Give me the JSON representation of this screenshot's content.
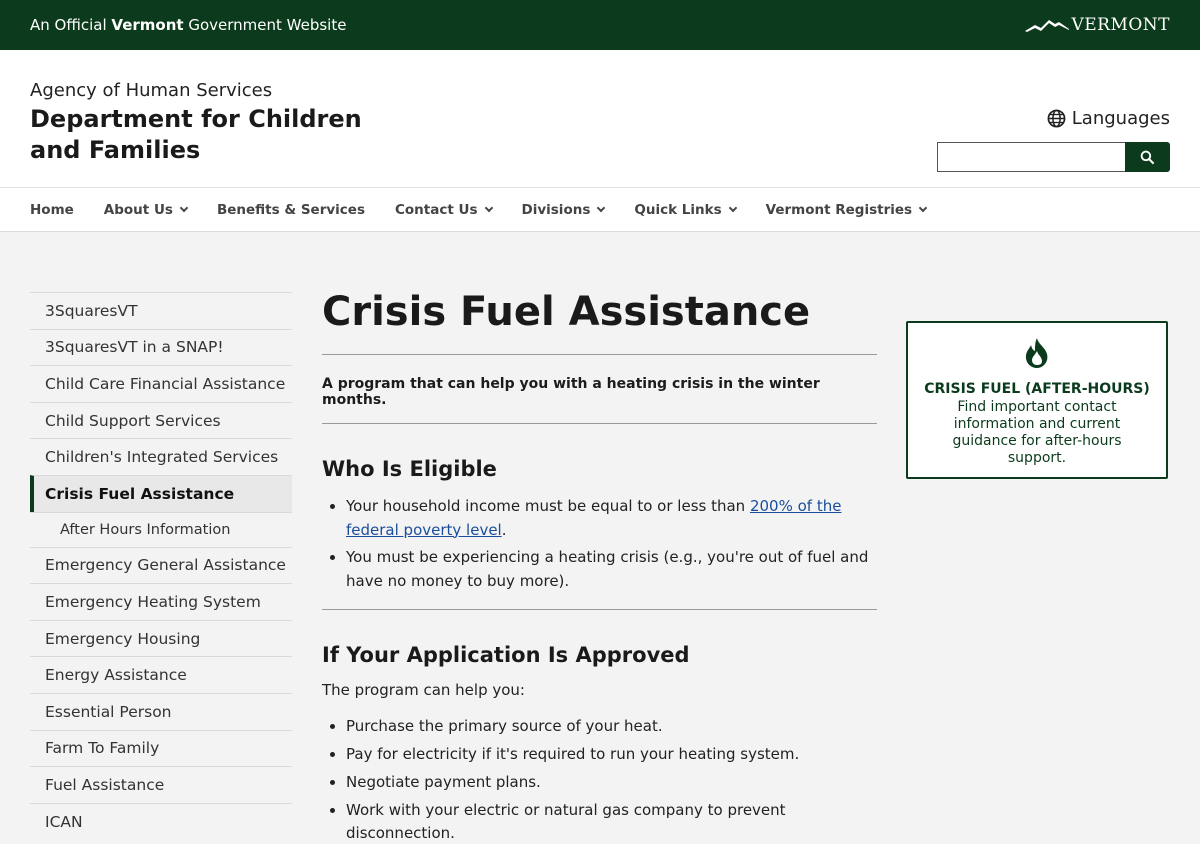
{
  "topbar": {
    "official_pre": "An Official",
    "official_bold": "Vermont",
    "official_post": "Government Website",
    "logo_text": "VERMONT"
  },
  "header": {
    "agency": "Agency of Human Services",
    "department": "Department for Children and Families",
    "languages_label": "Languages",
    "search_placeholder": ""
  },
  "nav": {
    "items": [
      {
        "label": "Home"
      },
      {
        "label": "About Us"
      },
      {
        "label": "Benefits & Services"
      },
      {
        "label": "Contact Us"
      },
      {
        "label": "Divisions"
      },
      {
        "label": "Quick Links"
      },
      {
        "label": "Vermont Registries"
      }
    ]
  },
  "sidebar": {
    "items": [
      {
        "label": "3SquaresVT"
      },
      {
        "label": "3SquaresVT in a SNAP!"
      },
      {
        "label": "Child Care Financial Assistance"
      },
      {
        "label": "Child Support Services"
      },
      {
        "label": "Children's Integrated Services"
      },
      {
        "label": "Crisis Fuel Assistance"
      },
      {
        "label": "After Hours Information"
      },
      {
        "label": "Emergency General Assistance"
      },
      {
        "label": "Emergency Heating System"
      },
      {
        "label": "Emergency Housing"
      },
      {
        "label": "Energy Assistance"
      },
      {
        "label": "Essential Person"
      },
      {
        "label": "Farm To Family"
      },
      {
        "label": "Fuel Assistance"
      },
      {
        "label": "ICAN"
      }
    ]
  },
  "main": {
    "title": "Crisis Fuel Assistance",
    "lead": "A program that can help you with a heating crisis in the winter months.",
    "eligible": {
      "heading": "Who Is Eligible",
      "item1_pre": "Your household income must be equal to or less than ",
      "item1_link": "200% of the federal poverty level",
      "item1_post": ".",
      "item2": "You must be experiencing a heating crisis (e.g., you're out of fuel and have no money to buy more)."
    },
    "approved": {
      "heading": "If Your Application Is Approved",
      "intro": "The program can help you:",
      "items": [
        "Purchase the primary source of your heat.",
        "Pay for electricity if it's required to run your heating system.",
        "Negotiate payment plans.",
        "Work with your electric or natural gas company to prevent disconnection."
      ]
    }
  },
  "callout": {
    "title": "CRISIS FUEL (AFTER-HOURS)",
    "body": "Find important contact information and current guidance for after-hours support."
  },
  "colors": {
    "brand_green": "#0b3b1c",
    "link_blue": "#1a4e9c"
  },
  "icons": [
    "globe-icon",
    "search-icon",
    "chevron-down-icon",
    "flame-icon",
    "vermont-logo"
  ]
}
